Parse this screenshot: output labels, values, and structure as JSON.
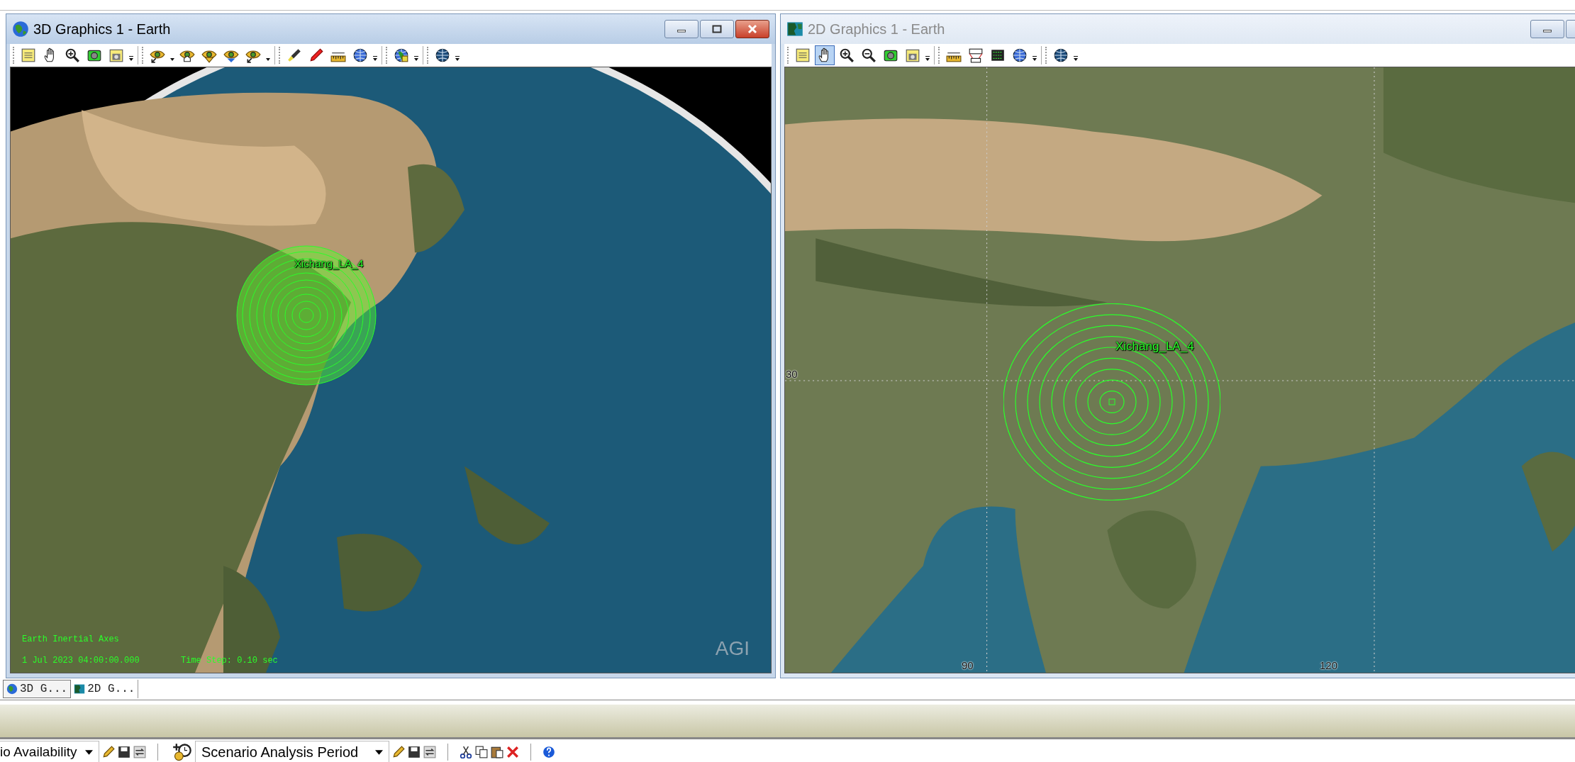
{
  "windows": [
    {
      "kind": "globe",
      "title": "3D Graphics 1 - Earth",
      "active": true,
      "pan_selected": false,
      "target_label": "Xichang_LA_4",
      "overlay": {
        "axes": "Earth Inertial Axes",
        "time": "1 Jul 2023 04:00:00.000",
        "time_step": "Time Step: 0.10 sec",
        "logo": "AGI"
      }
    },
    {
      "kind": "map",
      "title": "2D Graphics 1 - Earth",
      "active": false,
      "pan_selected": true,
      "target_label": "Xichang_LA_4",
      "latitude_labels": [
        "30"
      ],
      "longitude_labels": [
        "90",
        "120"
      ]
    }
  ],
  "tabs": [
    {
      "kind": "globe",
      "label": "3D G...",
      "selected": true
    },
    {
      "kind": "map",
      "label": "2D G...",
      "selected": false
    }
  ],
  "bottom_toolbar": {
    "availability_dropdown": "io Availability",
    "period_dropdown": "Scenario Analysis Period"
  }
}
